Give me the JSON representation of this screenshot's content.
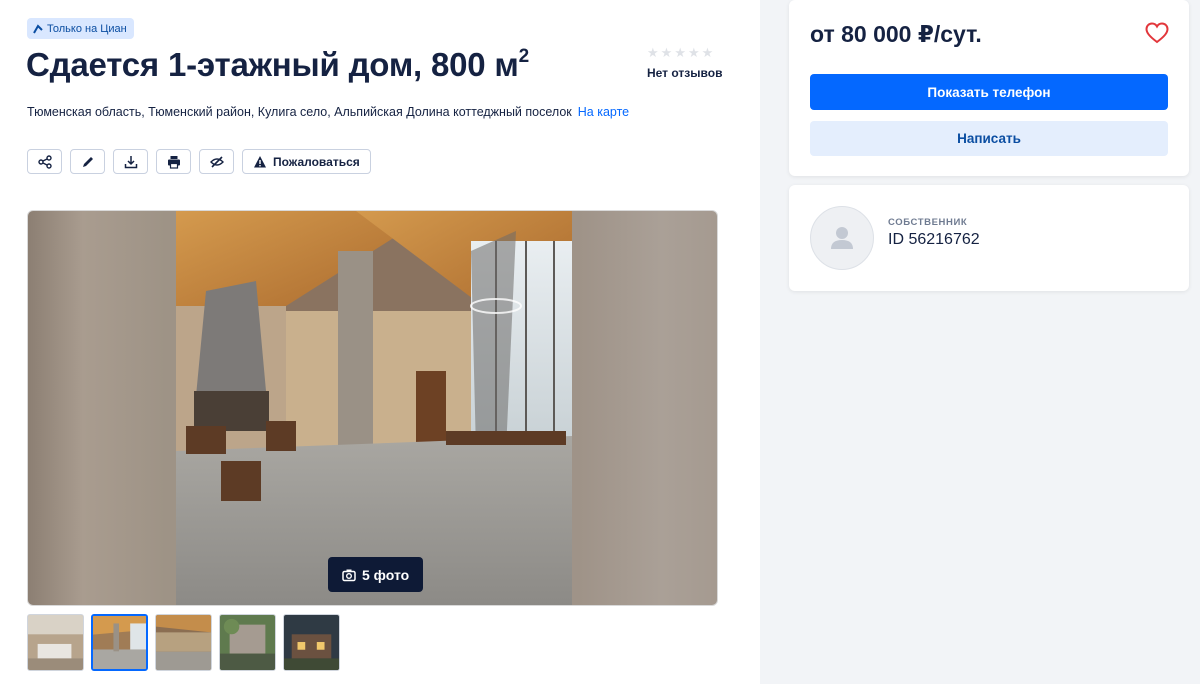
{
  "badge": {
    "text": "Только на Циан",
    "icon": "cian-logo-icon"
  },
  "title": {
    "text": "Сдается 1-этажный дом, 800 м",
    "sup": "2"
  },
  "rating": {
    "stars": 0,
    "max_stars": 5,
    "reviews_text": "Нет отзывов"
  },
  "address": {
    "text": "Тюменская область, Тюменский район, Кулига село, Альпийская Долина коттеджный поселок",
    "map_link": "На карте"
  },
  "actions": {
    "icons": [
      "share-icon",
      "edit-icon",
      "download-icon",
      "print-icon",
      "hide-icon"
    ],
    "complain_label": "Пожаловаться"
  },
  "gallery": {
    "photo_count_label": "5 фото",
    "thumbnails": 5,
    "active_thumbnail": 2
  },
  "sidebar": {
    "price": "от 80 000 ₽/сут.",
    "show_phone": "Показать телефон",
    "write": "Написать",
    "owner_role": "СОБСТВЕННИК",
    "owner_id": "ID 56216762"
  },
  "colors": {
    "accent": "#0468ff",
    "text": "#152242",
    "favorite": "#e2363b",
    "badge_bg": "#d9e7ff"
  }
}
